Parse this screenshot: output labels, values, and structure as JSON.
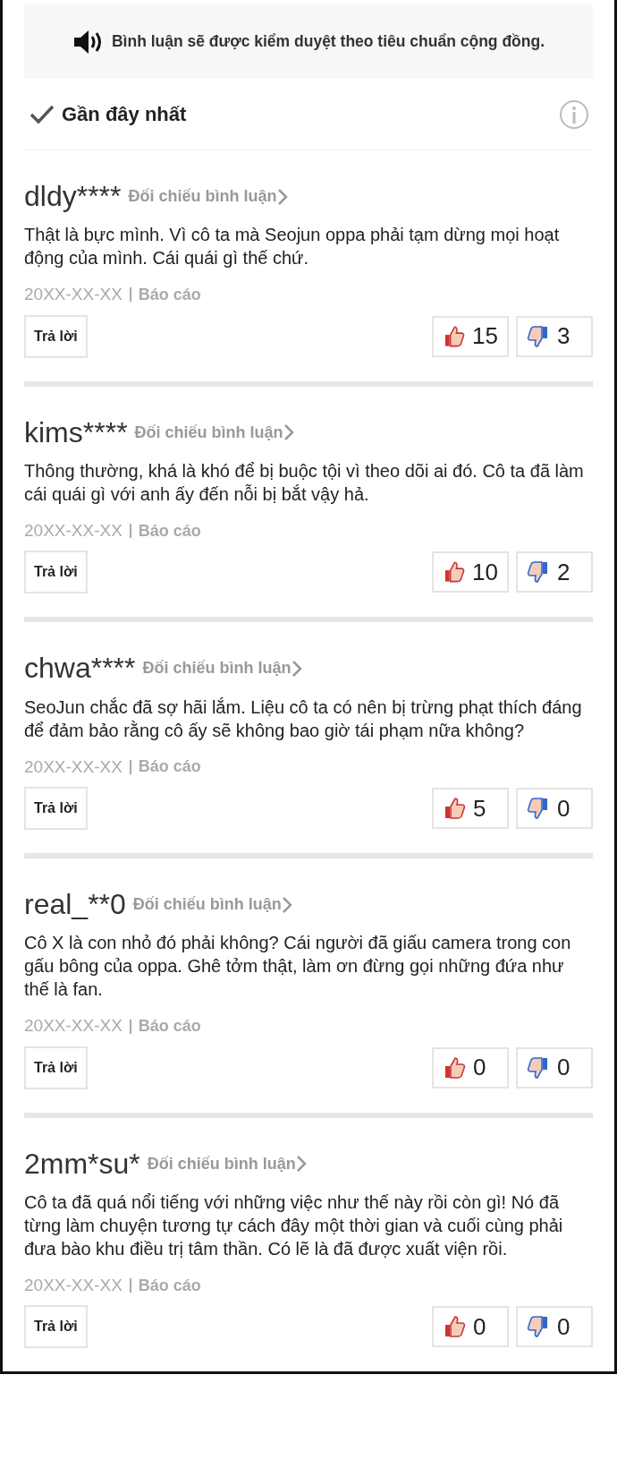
{
  "notice": {
    "text": "Bình luận sẽ được kiểm duyệt theo tiêu chuẩn cộng đồng."
  },
  "sort": {
    "label": "Gần đây nhất"
  },
  "comments": [
    {
      "user": "dldy****",
      "link": "Đối chiếu bình luận",
      "text": "Thật là bực mình. Vì cô ta mà Seojun oppa phải tạm dừng mọi hoạt động của mình. Cái quái gì thế chứ.",
      "date": "20XX-XX-XX",
      "report": "Báo cáo",
      "reply": "Trả lời",
      "likes": "15",
      "dislikes": "3"
    },
    {
      "user": "kims****",
      "link": "Đối chiếu bình luận",
      "text": "Thông thường, khá là khó để bị buộc tội vì theo dõi ai đó. Cô ta đã làm cái quái gì với anh ấy đến nỗi bị bắt vậy hả.",
      "date": "20XX-XX-XX",
      "report": "Báo cáo",
      "reply": "Trả lời",
      "likes": "10",
      "dislikes": "2"
    },
    {
      "user": "chwa****",
      "link": "Đối chiếu bình luận",
      "text": "SeoJun chắc đã sợ hãi lắm. Liệu cô ta có nên bị trừng phạt thích đáng để đảm bảo rằng cô ấy sẽ không bao giờ tái phạm nữa không?",
      "date": "20XX-XX-XX",
      "report": "Báo cáo",
      "reply": "Trả lời",
      "likes": "5",
      "dislikes": "0"
    },
    {
      "user": "real_**0",
      "link": "Đối chiếu bình luận",
      "text": "Cô X là con nhỏ đó phải không? Cái người đã giấu camera trong con gấu bông của oppa. Ghê tởm thật, làm ơn đừng gọi những đứa như thế là fan.",
      "date": "20XX-XX-XX",
      "report": "Báo cáo",
      "reply": "Trả lời",
      "likes": "0",
      "dislikes": "0"
    },
    {
      "user": "2mm*su*",
      "link": "Đối chiếu bình luận",
      "text": "Cô ta đã quá nổi tiếng với những việc như thế này rồi còn gì! Nó đã từng làm chuyện tương tự cách đây một thời gian và cuối cùng phải đưa bào khu điều trị tâm thần. Có lẽ là đã được xuất viện rồi.",
      "date": "20XX-XX-XX",
      "report": "Báo cáo",
      "reply": "Trả lời",
      "likes": "0",
      "dislikes": "0"
    }
  ]
}
